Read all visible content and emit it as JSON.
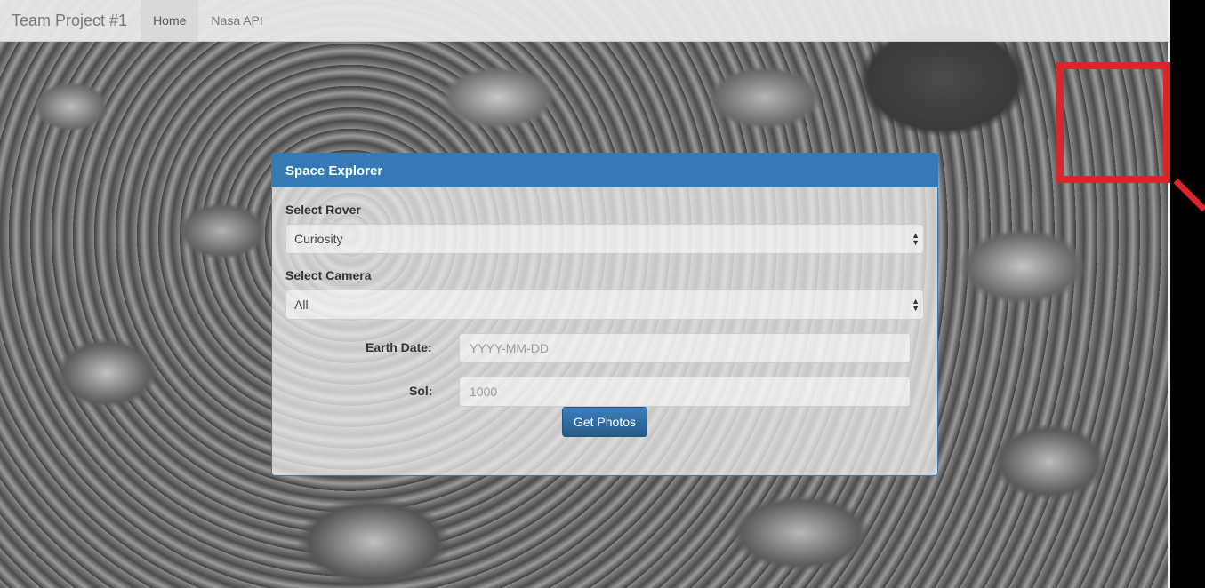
{
  "navbar": {
    "brand": "Team Project #1",
    "links": [
      "Home",
      "Nasa API"
    ],
    "active_index": 0
  },
  "panel": {
    "title": "Space Explorer",
    "rover": {
      "label": "Select Rover",
      "value": "Curiosity"
    },
    "camera": {
      "label": "Select Camera",
      "value": "All"
    },
    "earth_date": {
      "label": "Earth Date:",
      "placeholder": "YYYY-MM-DD"
    },
    "sol": {
      "label": "Sol:",
      "placeholder": "1000"
    },
    "submit_label": "Get Photos"
  },
  "colors": {
    "panel_primary": "#337ab7",
    "highlight_red": "#d8262b"
  }
}
